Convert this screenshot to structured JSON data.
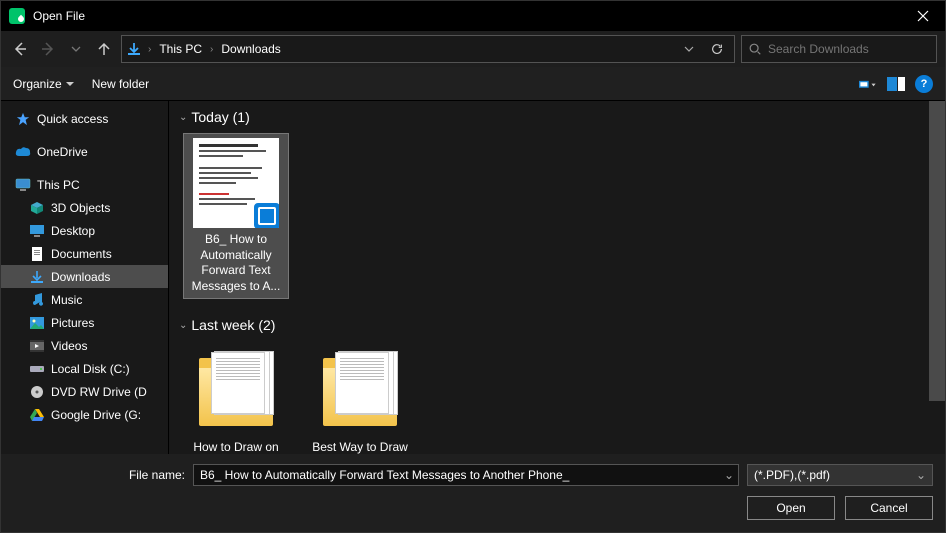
{
  "title": "Open File",
  "breadcrumb": {
    "level1": "This PC",
    "level2": "Downloads"
  },
  "search": {
    "placeholder": "Search Downloads"
  },
  "toolbar": {
    "organize": "Organize",
    "newfolder": "New folder"
  },
  "sidebar": {
    "quick": "Quick access",
    "onedrive": "OneDrive",
    "thispc": "This PC",
    "items": [
      "3D Objects",
      "Desktop",
      "Documents",
      "Downloads",
      "Music",
      "Pictures",
      "Videos",
      "Local Disk (C:)",
      "DVD RW Drive (D",
      "Google Drive (G:"
    ]
  },
  "groups": {
    "today": {
      "header": "Today (1)"
    },
    "lastweek": {
      "header": "Last week (2)"
    }
  },
  "files": {
    "sel": "B6_ How to Automatically Forward Text Messages to A...",
    "f1": "How to Draw on PDF Document",
    "f2": "Best Way to Draw on PDF - Quick"
  },
  "footer": {
    "filename_lbl": "File name:",
    "filename_val": "B6_ How to Automatically Forward Text Messages to Another Phone_",
    "filter": "(*.PDF),(*.pdf)",
    "open": "Open",
    "cancel": "Cancel"
  },
  "help_glyph": "?"
}
